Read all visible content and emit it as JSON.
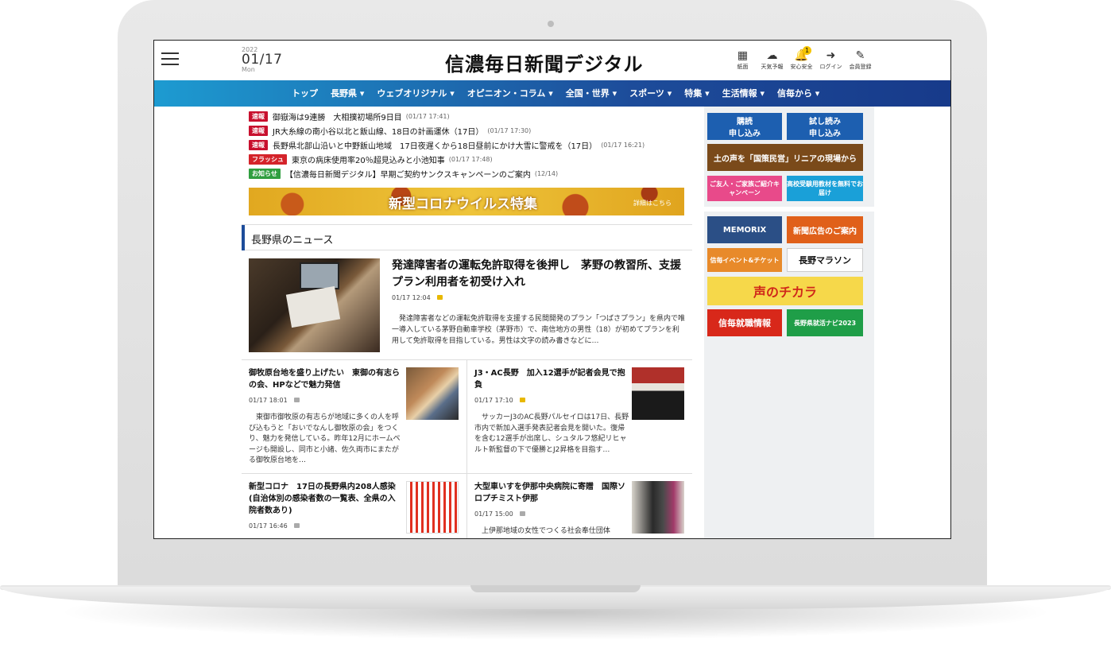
{
  "header": {
    "date": {
      "year": "2022",
      "month_day": "01/17",
      "weekday": "Mon"
    },
    "logo": "信濃毎日新聞デジタル",
    "icons": [
      {
        "icon": "newspaper-icon",
        "label": "紙面",
        "glyph": "▦"
      },
      {
        "icon": "weather-icon",
        "label": "天気予報",
        "glyph": "☁"
      },
      {
        "icon": "bell-icon",
        "label": "安心安全",
        "glyph": "🔔",
        "badge": "1"
      },
      {
        "icon": "login-icon",
        "label": "ログイン",
        "glyph": "➜"
      },
      {
        "icon": "register-icon",
        "label": "会員登録",
        "glyph": "✎"
      }
    ]
  },
  "nav": [
    "トップ",
    "長野県 ▾",
    "ウェブオリジナル ▾",
    "オピニオン・コラム ▾",
    "全国・世界 ▾",
    "スポーツ ▾",
    "特集 ▾",
    "生活情報 ▾",
    "信毎から ▾"
  ],
  "breaking": [
    {
      "tag": "速報",
      "color": "#c8102e",
      "text": "御嶽海は9連勝　大相撲初場所9日目",
      "time": "(01/17 17:41)"
    },
    {
      "tag": "速報",
      "color": "#c8102e",
      "text": "JR大糸線の南小谷以北と飯山線、18日の計画運休（17日）",
      "time": "(01/17 17:30)"
    },
    {
      "tag": "速報",
      "color": "#c8102e",
      "text": "長野県北部山沿いと中野飯山地域　17日夜遅くから18日昼前にかけ大雪に警戒を（17日）",
      "time": "(01/17 16:21)"
    },
    {
      "tag": "フラッシュ",
      "color": "#d4232a",
      "text": "東京の病床使用率20％超見込みと小池知事",
      "time": "(01/17 17:48)"
    },
    {
      "tag": "お知らせ",
      "color": "#2f9e3f",
      "text": "【信濃毎日新聞デジタル】早期ご契約サンクスキャンペーンのご案内",
      "time": "(12/14)"
    }
  ],
  "banner": {
    "title": "新型コロナウイルス特集",
    "link": "詳細はこちら"
  },
  "section_title": "長野県のニュース",
  "lead": {
    "title": "発達障害者の運転免許取得を後押し　茅野の教習所、支援プラン利用者を初受け入れ",
    "time": "01/17 12:04",
    "body": "　発達障害者などの運転免許取得を支援する民間開発のプラン「つばさプラン」を県内で唯一導入している茅野自動車学校（茅野市）で、南信地方の男性（18）が初めてプランを利用して免許取得を目指している。男性は文字の読み書きなどに…"
  },
  "cards": [
    {
      "title": "御牧原台地を盛り上げたい　東御の有志らの会、HPなどで魅力発信",
      "time": "01/17 18:01",
      "body": "　東御市御牧原の有志らが地域に多くの人を呼び込もうと「おいでなんし御牧原の会」をつくり、魅力を発信している。昨年12月にホームページも開設し、同市と小諸、佐久両市にまたがる御牧原台地を…"
    },
    {
      "title": "J3・AC長野　加入12選手が記者会見で抱負",
      "time": "01/17 17:10",
      "body": "　サッカーJ3のAC長野パルセイロは17日、長野市内で新加入選手発表記者会見を開いた。復帰を含む12選手が出席し、シュタルフ悠紀リヒャルト新監督の下で優勝とJ2昇格を目指す…"
    },
    {
      "title": "新型コロナ　17日の長野県内208人感染(自治体別の感染者数の一覧表、全県の入院者数あり)",
      "time": "01/17 16:46",
      "body": ""
    },
    {
      "title": "大型車いすを伊那中央病院に寄贈　国際ソロプチミスト伊那",
      "time": "01/17 15:00",
      "body": "　上伊那地域の女性でつくる社会奉仕団体"
    }
  ],
  "side_ads": [
    {
      "label": "購読\n申し込み",
      "bg": "#1d5fb0",
      "fg": "#ffffff"
    },
    {
      "label": "試し読み\n申し込み",
      "bg": "#1d5fb0",
      "fg": "#ffffff"
    },
    {
      "label": "土の声を「国策民営」リニアの現場から",
      "bg": "#7a4a1a",
      "fg": "#ffffff"
    },
    {
      "label": "ご友人・ご家族ご紹介キャンペーン",
      "bg": "#e84a8a",
      "fg": "#ffffff"
    },
    {
      "label": "高校受験用教材を無料でお届け",
      "bg": "#1aa0d8",
      "fg": "#ffffff"
    },
    {
      "label": "MEMORIX",
      "bg": "#2b4f86",
      "fg": "#ffffff"
    },
    {
      "label": "新聞広告のご案内",
      "bg": "#e0601a",
      "fg": "#ffffff"
    },
    {
      "label": "信毎イベント&チケット",
      "bg": "#e88a2a",
      "fg": "#ffffff"
    },
    {
      "label": "長野マラソン",
      "bg": "#ffffff",
      "fg": "#111111"
    },
    {
      "label": "声のチカラ",
      "bg": "#f6d84a",
      "fg": "#d0281a"
    },
    {
      "label": "信毎就職情報",
      "bg": "#d8281a",
      "fg": "#ffffff"
    },
    {
      "label": "長野県就活ナビ2023",
      "bg": "#1f9e48",
      "fg": "#ffffff"
    }
  ]
}
